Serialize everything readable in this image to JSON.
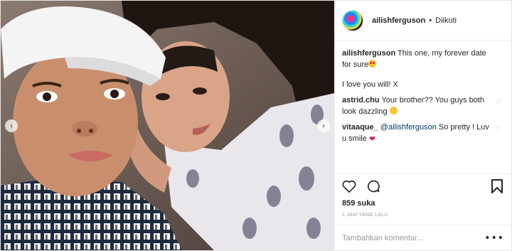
{
  "post": {
    "username": "ailishferguson",
    "separator": "•",
    "follow_status": "Diikuti",
    "caption_user": "ailishferguson",
    "caption_text": "This one, my forever date for sure",
    "caption_emoji": "smiling-face-with-heart-eyes",
    "comments": [
      {
        "text": "I love you will! X"
      },
      {
        "user": "astrid.chu",
        "text": "Your brother?? You guys both look dazzling",
        "emoji": "smile"
      },
      {
        "user": "vitaaque_",
        "mention": "@ailishferguson",
        "text": "So pretty ! Luv u smile",
        "emoji": "red-heart"
      }
    ],
    "likes": "859 suka",
    "timestamp": "1 JAM YANG LALU",
    "comment_placeholder": "Tambahkan komentar...",
    "more_label": "•••"
  },
  "icons": {
    "like": "heart-icon",
    "comment": "comment-icon",
    "save": "bookmark-icon",
    "prev": "chevron-left-icon",
    "next": "chevron-right-icon"
  },
  "colors": {
    "text": "#262626",
    "muted": "#999999",
    "mention": "#003569",
    "border": "#efefef",
    "heart_emoji": "#e0245e"
  },
  "carousel": {
    "prev_label": "‹",
    "next_label": "›"
  }
}
